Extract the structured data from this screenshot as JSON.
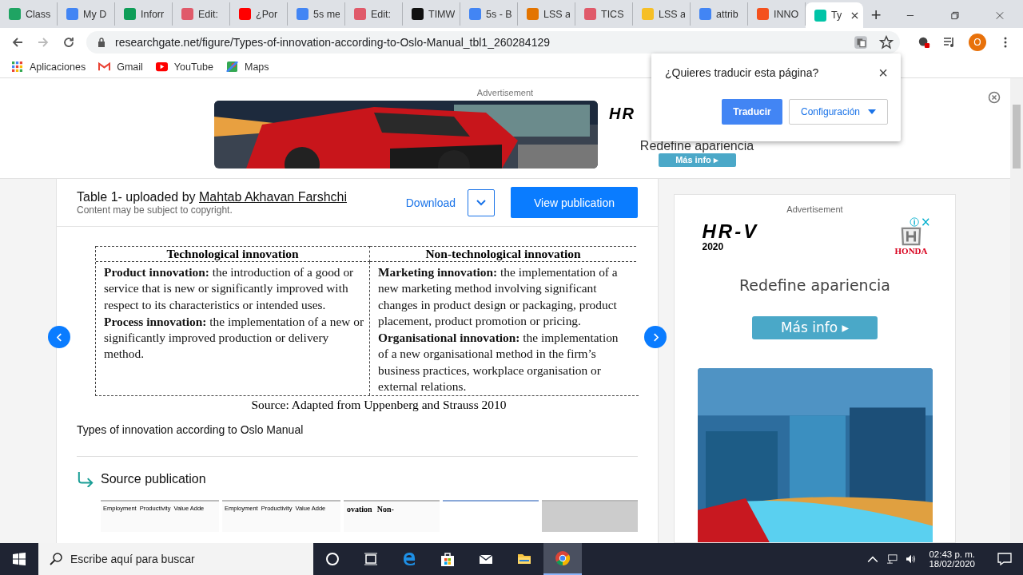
{
  "browser": {
    "tabs": [
      {
        "title": "Class",
        "color": "#1fa463",
        "selected": false
      },
      {
        "title": "My D",
        "color": "#4285f4",
        "selected": false
      },
      {
        "title": "Inforr",
        "color": "#0f9d58",
        "selected": false
      },
      {
        "title": "Edit:",
        "color": "#e05a6a",
        "selected": false
      },
      {
        "title": "¿Por",
        "color": "#ff0000",
        "selected": false
      },
      {
        "title": "5s me",
        "color": "#4285f4",
        "selected": false
      },
      {
        "title": "Edit:",
        "color": "#e05a6a",
        "selected": false
      },
      {
        "title": "TIMW",
        "color": "#111111",
        "selected": false
      },
      {
        "title": "5s - B",
        "color": "#4285f4",
        "selected": false
      },
      {
        "title": "LSS a",
        "color": "#e37400",
        "selected": false
      },
      {
        "title": "TICS",
        "color": "#e05a6a",
        "selected": false
      },
      {
        "title": "LSS a",
        "color": "#f6bf26",
        "selected": false
      },
      {
        "title": "attrib",
        "color": "#4285f4",
        "selected": false
      },
      {
        "title": "INNO",
        "color": "#f4511e",
        "selected": false
      },
      {
        "title": "Ty",
        "color": "#00c4a7",
        "selected": true
      }
    ],
    "new_tab": "+",
    "address": "researchgate.net/figure/Types-of-innovation-according-to-Oslo-Manual_tbl1_260284129",
    "avatar": "O",
    "bookmarks": [
      "Aplicaciones",
      "Gmail",
      "YouTube",
      "Maps"
    ]
  },
  "translate_popup": {
    "question": "¿Quieres traducir esta página?",
    "close": "×",
    "translate_button": "Traducir",
    "settings_button": "Configuración"
  },
  "top_ad": {
    "label": "Advertisement",
    "logo": "HR",
    "slogan": "Redefine apariencia",
    "button": "Más info ▸"
  },
  "figure": {
    "title_prefix": "Table 1- uploaded by ",
    "author": "Mahtab Akhavan Farshchi",
    "copyright": "Content may be subject to copyright.",
    "download": "Download",
    "view_button": "View publication",
    "table": {
      "columns": [
        "Technological innovation",
        "Non-technological innovation"
      ],
      "cells": [
        [
          "**Product innovation:** the introduction of a good or service that is new or significantly improved with respect to its characteristics or intended uses.",
          "**Process innovation:** the implementation of a new or significantly improved production or delivery method."
        ],
        [
          "**Marketing innovation:** the implementation of a new marketing method involving significant changes in product design or packaging, product placement, product promotion or pricing.",
          "**Organisational innovation:** the implementation of a new organisational method in the firm’s business practices, workplace organisation or external relations."
        ]
      ],
      "source": "Source: Adapted from Uppenberg and Strauss 2010"
    },
    "caption": "Types of innovation according to Oslo Manual",
    "source_heading": "Source publication",
    "thumbnails": [
      {
        "kind": "legend",
        "texts": [
          "Employment",
          "Productivity",
          "Value Adde"
        ]
      },
      {
        "kind": "legend",
        "texts": [
          "Employment",
          "Productivity",
          "Value Adde"
        ]
      },
      {
        "kind": "table",
        "texts": [
          "ovation",
          "Non-"
        ]
      },
      {
        "kind": "blank"
      },
      {
        "kind": "grid"
      }
    ]
  },
  "side_ad": {
    "label": "Advertisement",
    "model": "HR-V",
    "year": "2020",
    "brand": "HONDA",
    "slogan": "Redefine apariencia",
    "button": "Más info ▸"
  },
  "taskbar": {
    "search_placeholder": "Escribe aquí para buscar",
    "time": "02:43 p. m.",
    "date": "18/02/2020"
  }
}
